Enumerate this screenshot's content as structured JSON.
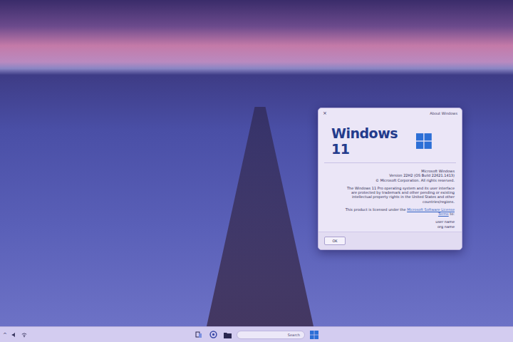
{
  "desktop": {
    "wallpaper": "photo"
  },
  "dialog": {
    "title": "About Windows",
    "close": "×",
    "product": "Windows 11",
    "lines": [
      "Microsoft Windows",
      "Version 22H2 (OS Build 22621.1413)",
      "© Microsoft Corporation. All rights reserved."
    ],
    "paragraph": "The Windows 11 Pro operating system and its user interface are protected by trademark and other pending or existing intellectual property rights in the United States and other countries/regions.",
    "license_text": "This product is licensed under the",
    "license_link": "Microsoft Software License Terms",
    "license_suffix": "to:",
    "licensees": [
      "user name",
      "org name"
    ],
    "button": "OK"
  },
  "taskbar": {
    "tray_chevron": "^",
    "search_placeholder": "Search"
  }
}
